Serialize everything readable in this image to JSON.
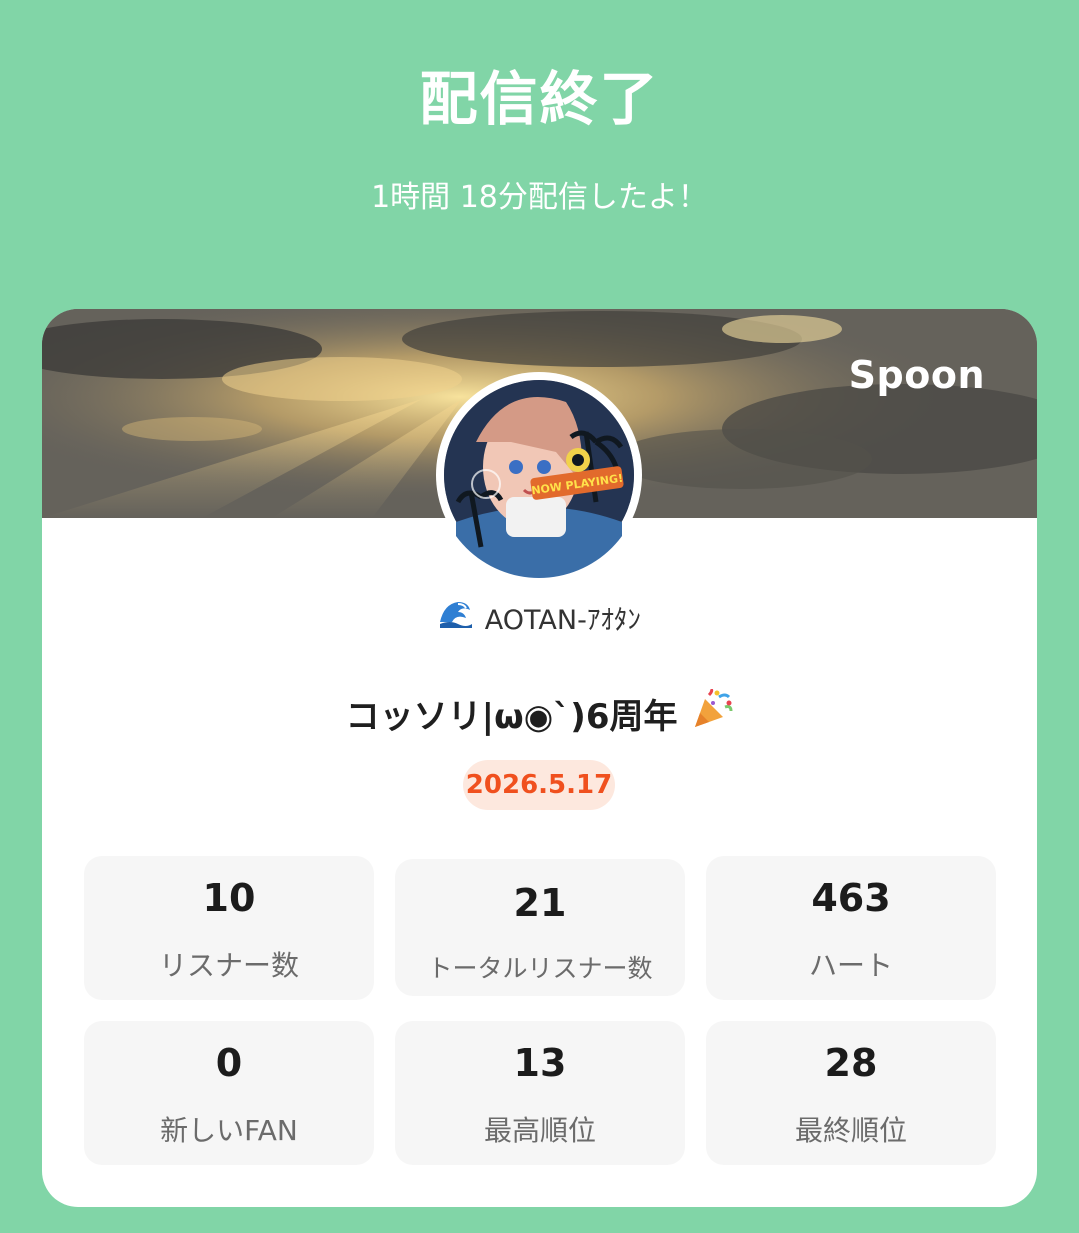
{
  "header": {
    "title": "配信終了",
    "subtitle": "1時間 18分配信したよ！"
  },
  "card": {
    "brand": "Spoon",
    "avatar_overlay_text": "NOW PLAYING!",
    "username": "AOTAN-ｱｵﾀﾝ",
    "username_icon": "wave-emoji",
    "live_title": "コッソリ|ω◉`)6周年",
    "live_title_icon": "party-popper-emoji",
    "date": "2026.5.17"
  },
  "stats": [
    {
      "value": "10",
      "label": "リスナー数"
    },
    {
      "value": "21",
      "label": "トータルリスナー数"
    },
    {
      "value": "463",
      "label": "ハート"
    },
    {
      "value": "0",
      "label": "新しいFAN"
    },
    {
      "value": "13",
      "label": "最高順位"
    },
    {
      "value": "28",
      "label": "最終順位"
    }
  ],
  "colors": {
    "background": "#81d5a7",
    "card": "#ffffff",
    "date_badge_bg": "#fde8de",
    "date_badge_text": "#f0501e",
    "stat_bg": "#f6f6f6"
  }
}
